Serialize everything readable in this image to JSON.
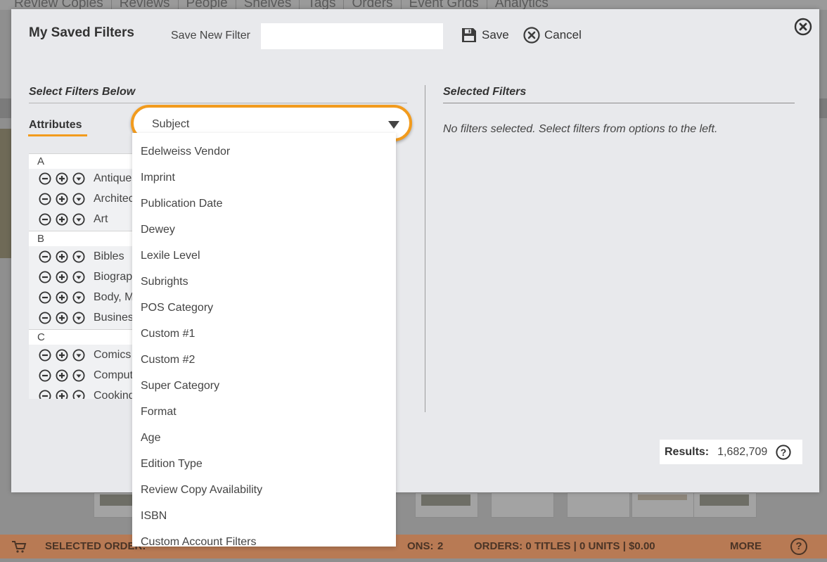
{
  "background": {
    "nav_tabs": [
      "Review Copies",
      "Reviews",
      "People",
      "Shelves",
      "Tags",
      "Orders",
      "Event Grids",
      "Analytics"
    ],
    "bottom_bar": {
      "selected_order": "SELECTED ORDER:",
      "options": "ONS:",
      "options_count": "2",
      "orders": "ORDERS: 0 TITLES | 0 UNITS | $0.00",
      "more": "MORE",
      "help": "?"
    }
  },
  "modal": {
    "title": "My Saved Filters",
    "save_new_filter_label": "Save New Filter",
    "save_new_filter_value": "",
    "save_label": "Save",
    "cancel_label": "Cancel"
  },
  "left": {
    "heading": "Select Filters Below",
    "attributes_label": "Attributes",
    "dropdown_value": "Subject",
    "groups": [
      {
        "letter": "A",
        "items": [
          "Antiques",
          "Architecture",
          "Art"
        ]
      },
      {
        "letter": "B",
        "items": [
          "Bibles",
          "Biography",
          "Body, Mind",
          "Business"
        ]
      },
      {
        "letter": "C",
        "items": [
          "Comics &",
          "Computers",
          "Cooking"
        ]
      }
    ],
    "dropdown_options": [
      "Edelweiss Vendor",
      "Imprint",
      "Publication Date",
      "Dewey",
      "Lexile Level",
      "Subrights",
      "POS Category",
      "Custom #1",
      "Custom #2",
      "Super Category",
      "Format",
      "Age",
      "Edition Type",
      "Review Copy Availability",
      "ISBN",
      "Custom Account Filters"
    ]
  },
  "right": {
    "heading": "Selected Filters",
    "empty_message": "No filters selected. Select filters from options to the left."
  },
  "results": {
    "label": "Results:",
    "value": "1,682,709",
    "help": "?"
  },
  "colors": {
    "accent_orange": "#f29b1d",
    "modal_bg": "#e8e9ec",
    "bottom_bar": "#b87a54"
  }
}
